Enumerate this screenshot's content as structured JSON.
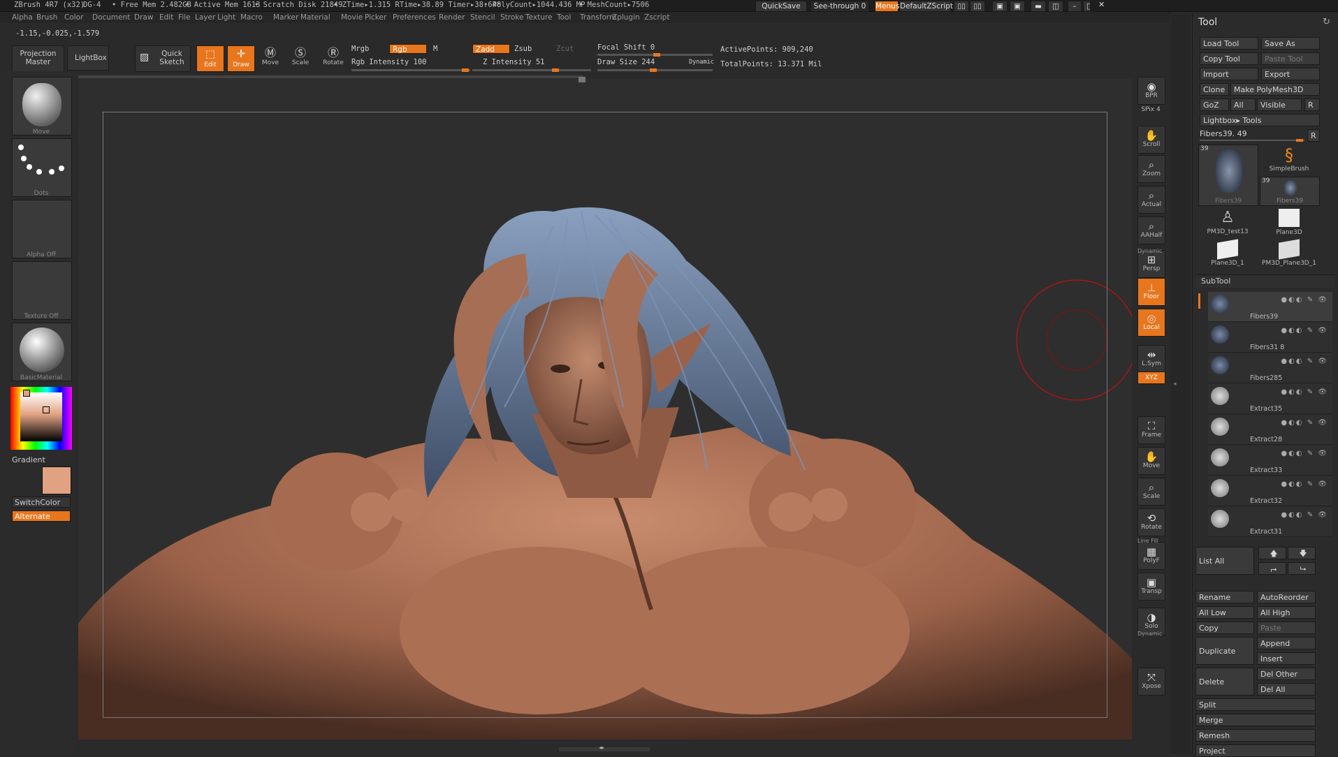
{
  "status_bar": {
    "app": "ZBrush 4R7 (x32)",
    "doc": "DG-4",
    "free_mem": "• Free Mem 2.482GB",
    "active_mem": "• Active Mem 1613",
    "scratch": "• Scratch Disk 21849",
    "ztime": "• ZTime▸1.315 RTime▸38.89 Timer▸38.648",
    "polycount": "• PolyCount▸1044.436 MP",
    "meshcount": "• MeshCount▸7506",
    "quicksave": "QuickSave",
    "seethrough": "See-through  0",
    "menus": "Menus",
    "script": "DefaultZScript"
  },
  "menu_items": [
    "Alpha",
    "Brush",
    "Color",
    "Document",
    "Draw",
    "Edit",
    "File",
    "Layer",
    "Light",
    "Macro",
    "Marker",
    "Material",
    "Movie",
    "Picker",
    "Preferences",
    "Render",
    "Stencil",
    "Stroke",
    "Texture",
    "Tool",
    "Transform",
    "Zplugin",
    "Zscript"
  ],
  "coords": "-1.15,-0.025,-1.579",
  "toolbar": {
    "projection_master": "Projection Master",
    "lightbox": "LightBox",
    "quick_sketch": "Quick Sketch",
    "edit": "Edit",
    "draw": "Draw",
    "move": "Move",
    "scale": "Scale",
    "rotate": "Rotate",
    "mrgb": "Mrgb",
    "rgb": "Rgb",
    "m": "M",
    "zadd": "Zadd",
    "zsub": "Zsub",
    "zcut": "Zcut",
    "rgb_intensity": "Rgb Intensity 100",
    "z_intensity": "Z Intensity 51",
    "focal_shift": "Focal Shift 0",
    "draw_size": "Draw Size 244",
    "dynamic": "Dynamic",
    "active_points": "ActivePoints: 909,240",
    "total_points": "TotalPoints: 13.371 Mil"
  },
  "left_shelf": {
    "brush_caption": "Move",
    "stroke_caption": "Dots",
    "alpha_caption": "Alpha  Off",
    "texture_caption": "Texture  Off",
    "material_caption": "BasicMaterial",
    "gradient": "Gradient",
    "switchcolor": "SwitchColor",
    "alternate": "Alternate",
    "main_color": "#e0a283"
  },
  "right_shelf": [
    {
      "label": "BPR",
      "icon": "bpr-icon"
    },
    {
      "label": "SPix 4",
      "icon": "spix-icon"
    },
    {
      "label": "Scroll",
      "icon": "scroll-icon"
    },
    {
      "label": "Zoom",
      "icon": "zoom-icon"
    },
    {
      "label": "Actual",
      "icon": "actual-icon"
    },
    {
      "label": "AAHalf",
      "icon": "aahalf-icon"
    },
    {
      "label": "Persp",
      "icon": "persp-icon"
    },
    {
      "label": "Floor",
      "icon": "floor-icon"
    },
    {
      "label": "Local",
      "icon": "local-icon"
    },
    {
      "label": "L.Sym",
      "icon": "lsym-icon"
    },
    {
      "label": "XYZ",
      "icon": "xyz-icon"
    },
    {
      "label": "Frame",
      "icon": "frame-icon"
    },
    {
      "label": "Move",
      "icon": "move-icon"
    },
    {
      "label": "Scale",
      "icon": "scale-icon"
    },
    {
      "label": "Rotate",
      "icon": "rotate-icon"
    },
    {
      "label": "PolyF",
      "icon": "polyf-icon"
    },
    {
      "label": "Transp",
      "icon": "transp-icon"
    },
    {
      "label": "Solo",
      "icon": "solo-icon"
    },
    {
      "label": "Xpose",
      "icon": "xpose-icon"
    }
  ],
  "right_shelf_extra": {
    "dynamic": "Dynamic",
    "line_fill": "Line Fill",
    "dynamic2": "Dynamic"
  },
  "tool_panel": {
    "title": "Tool",
    "load_tool": "Load Tool",
    "save_as": "Save As",
    "copy_tool": "Copy Tool",
    "paste_tool": "Paste Tool",
    "import": "Import",
    "export": "Export",
    "clone": "Clone",
    "make_polymesh": "Make PolyMesh3D",
    "goz": "GoZ",
    "all": "All",
    "visible": "Visible",
    "r": "R",
    "lightbox_tools": "Lightbox▸ Tools",
    "current_tool": "Fibers39. 49",
    "tools": [
      {
        "name": "Fibers39",
        "count": "39"
      },
      {
        "name": "SimpleBrush",
        "count": ""
      },
      {
        "name": "Fibers39",
        "count": "39"
      },
      {
        "name": "PM3D_test13",
        "count": ""
      },
      {
        "name": "Plane3D",
        "count": ""
      },
      {
        "name": "Plane3D_1",
        "count": ""
      },
      {
        "name": "PM3D_Plane3D_1",
        "count": ""
      }
    ],
    "subtool_title": "SubTool",
    "subtools": [
      "Fibers39",
      "Fibers31 8",
      "Fibers285",
      "Extract35",
      "Extract28",
      "Extract33",
      "Extract32",
      "Extract31"
    ],
    "list_all": "List  All",
    "rename": "Rename",
    "autoreorder": "AutoReorder",
    "all_low": "All Low",
    "all_high": "All High",
    "copy": "Copy",
    "paste": "Paste",
    "append": "Append",
    "duplicate": "Duplicate",
    "insert": "Insert",
    "delete": "Delete",
    "del_other": "Del Other",
    "del_all": "Del All",
    "split": "Split",
    "merge": "Merge",
    "remesh": "Remesh",
    "project": "Project"
  }
}
